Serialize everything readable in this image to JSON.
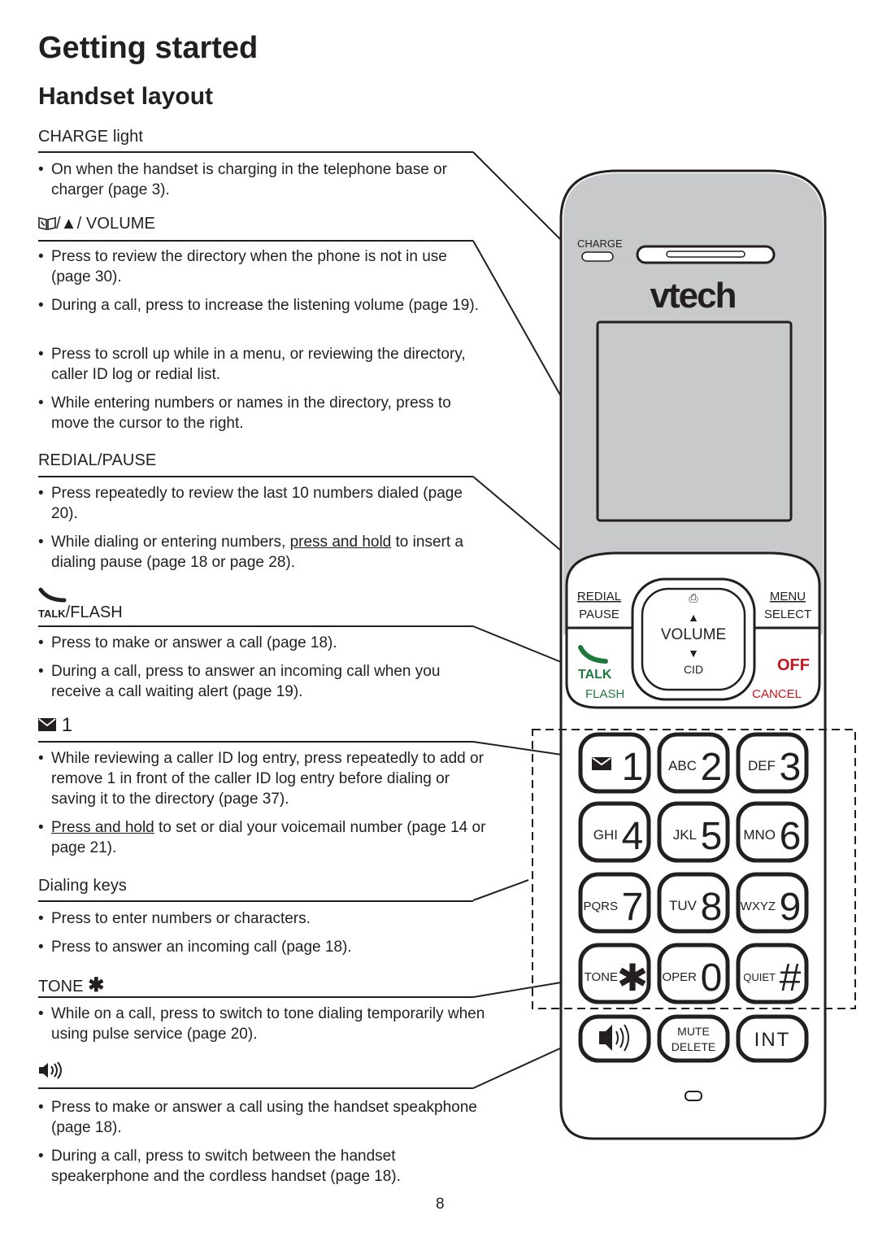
{
  "page": {
    "title": "Getting started",
    "subtitle": "Handset layout",
    "page_number": "8"
  },
  "sections": [
    {
      "id": "charge",
      "heading": "CHARGE light",
      "bullets": [
        {
          "text": "On when the handset is charging in the telephone base or charger (page 3)."
        }
      ]
    },
    {
      "id": "volume",
      "heading": "/▲/ VOLUME",
      "icons": [
        "directory-book-icon",
        "up-arrow-icon"
      ],
      "bullets": [
        {
          "text": "Press to review the directory when the phone is not in use (page 30)."
        },
        {
          "text": "During a call, press to increase the listening volume (page 19)."
        },
        {
          "text": "Press to scroll up while in a menu, or reviewing the directory, caller ID log or redial list."
        },
        {
          "text": "While entering numbers or names in the directory, press to move the cursor to the right."
        }
      ]
    },
    {
      "id": "redial",
      "heading": "REDIAL/PAUSE",
      "bullets": [
        {
          "text": "Press repeatedly to review the last 10 numbers dialed (page 20)."
        },
        {
          "pre": "While dialing or entering numbers, ",
          "link": "press and hold",
          "post": " to insert a dialing pause (page 18 or page 28)."
        }
      ]
    },
    {
      "id": "talk",
      "heading": "/FLASH",
      "icon_label": "TALK",
      "bullets": [
        {
          "text": "Press to make or answer a call (page 18)."
        },
        {
          "text": "During a call, press to answer an incoming call when you receive a call waiting alert (page 19)."
        }
      ]
    },
    {
      "id": "voicemail",
      "heading": "1",
      "bullets": [
        {
          "text": "While reviewing a caller ID log entry, press repeatedly to add or remove 1 in front of the caller ID log entry before dialing or saving it to the directory (page 37)."
        },
        {
          "pre": "",
          "link": "Press and hold",
          "post": " to set or dial your voicemail number (page 14 or page 21)."
        }
      ]
    },
    {
      "id": "dialing",
      "heading": "Dialing keys",
      "bullets": [
        {
          "text": "Press to enter numbers or characters."
        },
        {
          "text": "Press to answer an incoming call (page 18)."
        }
      ]
    },
    {
      "id": "tone",
      "heading": "TONE",
      "bullets": [
        {
          "text": "While on a call, press to switch to tone dialing temporarily when using pulse service (page 20)."
        }
      ]
    },
    {
      "id": "speaker",
      "heading": "",
      "bullets": [
        {
          "text": "Press to make or answer a call using the handset speakphone (page 18)."
        },
        {
          "text": "During a call, press to switch between the handset speakerphone and the cordless handset (page 18)."
        }
      ]
    }
  ],
  "handset": {
    "brand": "vtech",
    "charge_label": "CHARGE",
    "redial": "REDIAL",
    "pause": "PAUSE",
    "menu": "MENU",
    "select": "SELECT",
    "volume": "VOLUME",
    "cid": "CID",
    "talk": "TALK",
    "flash": "FLASH",
    "off": "OFF",
    "cancel": "CANCEL",
    "keys": [
      {
        "letters": "",
        "digit": "1",
        "icon": "voicemail"
      },
      {
        "letters": "ABC",
        "digit": "2"
      },
      {
        "letters": "DEF",
        "digit": "3"
      },
      {
        "letters": "GHI",
        "digit": "4"
      },
      {
        "letters": "JKL",
        "digit": "5"
      },
      {
        "letters": "MNO",
        "digit": "6"
      },
      {
        "letters": "PQRS",
        "digit": "7"
      },
      {
        "letters": "TUV",
        "digit": "8"
      },
      {
        "letters": "WXYZ",
        "digit": "9"
      },
      {
        "letters": "TONE",
        "digit": "*"
      },
      {
        "letters": "OPER",
        "digit": "0"
      },
      {
        "letters": "QUIET",
        "digit": "#"
      }
    ],
    "mute": "MUTE",
    "delete": "DELETE",
    "int": "INT",
    "colors": {
      "talk_green": "#1e7a3c",
      "off_red": "#c4161c",
      "top_gray": "#c8c9cb"
    }
  }
}
